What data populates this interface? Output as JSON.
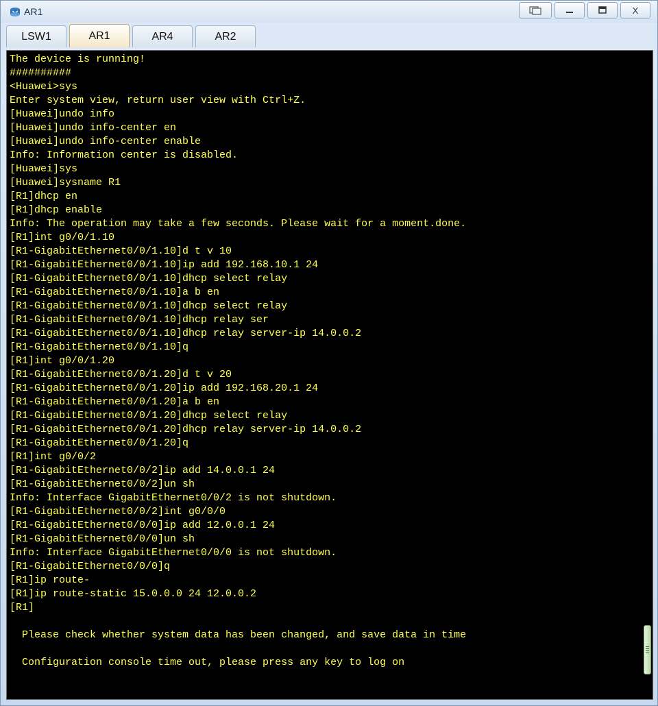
{
  "window": {
    "title": "AR1",
    "controls": [
      "restore-alt",
      "minimize",
      "maximize",
      "close"
    ],
    "close_label": "X"
  },
  "tabs": [
    {
      "label": "LSW1",
      "active": false
    },
    {
      "label": "AR1",
      "active": true
    },
    {
      "label": "AR4",
      "active": false
    },
    {
      "label": "AR2",
      "active": false
    }
  ],
  "console": {
    "text_color": "#ffff55",
    "background": "#000000",
    "lines": [
      "The device is running!",
      "##########",
      "<Huawei>sys",
      "Enter system view, return user view with Ctrl+Z.",
      "[Huawei]undo info",
      "[Huawei]undo info-center en",
      "[Huawei]undo info-center enable",
      "Info: Information center is disabled.",
      "[Huawei]sys",
      "[Huawei]sysname R1",
      "[R1]dhcp en",
      "[R1]dhcp enable",
      "Info: The operation may take a few seconds. Please wait for a moment.done.",
      "[R1]int g0/0/1.10",
      "[R1-GigabitEthernet0/0/1.10]d t v 10",
      "[R1-GigabitEthernet0/0/1.10]ip add 192.168.10.1 24",
      "[R1-GigabitEthernet0/0/1.10]dhcp select relay",
      "[R1-GigabitEthernet0/0/1.10]a b en",
      "[R1-GigabitEthernet0/0/1.10]dhcp select relay",
      "[R1-GigabitEthernet0/0/1.10]dhcp relay ser",
      "[R1-GigabitEthernet0/0/1.10]dhcp relay server-ip 14.0.0.2",
      "[R1-GigabitEthernet0/0/1.10]q",
      "[R1]int g0/0/1.20",
      "[R1-GigabitEthernet0/0/1.20]d t v 20",
      "[R1-GigabitEthernet0/0/1.20]ip add 192.168.20.1 24",
      "[R1-GigabitEthernet0/0/1.20]a b en",
      "[R1-GigabitEthernet0/0/1.20]dhcp select relay",
      "[R1-GigabitEthernet0/0/1.20]dhcp relay server-ip 14.0.0.2",
      "[R1-GigabitEthernet0/0/1.20]q",
      "[R1]int g0/0/2",
      "[R1-GigabitEthernet0/0/2]ip add 14.0.0.1 24",
      "[R1-GigabitEthernet0/0/2]un sh",
      "Info: Interface GigabitEthernet0/0/2 is not shutdown.",
      "[R1-GigabitEthernet0/0/2]int g0/0/0",
      "[R1-GigabitEthernet0/0/0]ip add 12.0.0.1 24",
      "[R1-GigabitEthernet0/0/0]un sh",
      "Info: Interface GigabitEthernet0/0/0 is not shutdown.",
      "[R1-GigabitEthernet0/0/0]q",
      "[R1]ip route-",
      "[R1]ip route-static 15.0.0.0 24 12.0.0.2",
      "[R1]",
      "",
      "  Please check whether system data has been changed, and save data in time",
      "",
      "  Configuration console time out, please press any key to log on"
    ]
  }
}
